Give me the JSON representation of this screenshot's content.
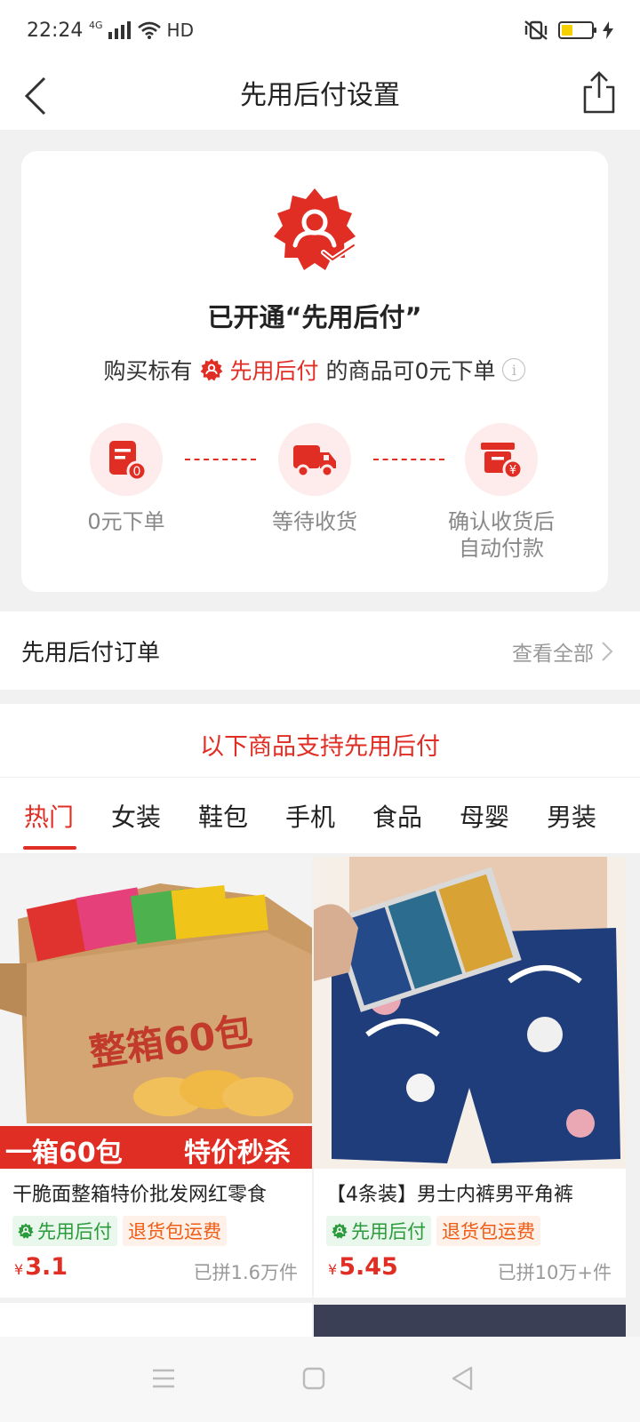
{
  "status_bar": {
    "time": "22:24",
    "network": "4G",
    "wifi_label": "HD"
  },
  "nav": {
    "title": "先用后付设置"
  },
  "card": {
    "title": "已开通“先用后付”",
    "sub_prefix": "购买标有",
    "sub_highlight": "先用后付",
    "sub_suffix": "的商品可0元下单",
    "steps": [
      {
        "label": "0元下单",
        "icon": "document-zero-icon"
      },
      {
        "label": "等待收货",
        "icon": "truck-icon"
      },
      {
        "label_line1": "确认收货后",
        "label_line2": "自动付款",
        "icon": "wallet-yen-icon"
      }
    ]
  },
  "orders": {
    "title": "先用后付订单",
    "link": "查看全部"
  },
  "section": {
    "title": "以下商品支持先用后付",
    "tabs": [
      "热门",
      "女装",
      "鞋包",
      "手机",
      "食品",
      "母婴",
      "男装"
    ],
    "active_tab": "热门"
  },
  "products": [
    {
      "name": "干脆面整箱特价批发网红零食",
      "tag_pay": "先用后付",
      "tag_return": "退货包运费",
      "currency": "¥",
      "price": "3.1",
      "sold": "已拼1.6万件",
      "banner_left": "一箱60包",
      "banner_right": "特价秒杀",
      "box_text": "整箱60包"
    },
    {
      "name": "【4条装】男士内裤男平角裤",
      "tag_pay": "先用后付",
      "tag_return": "退货包运费",
      "currency": "¥",
      "price": "5.45",
      "sold": "已拼10万+件"
    }
  ],
  "colors": {
    "accent": "#e02e24",
    "green": "#2a9b3b",
    "orange": "#f05c14"
  }
}
